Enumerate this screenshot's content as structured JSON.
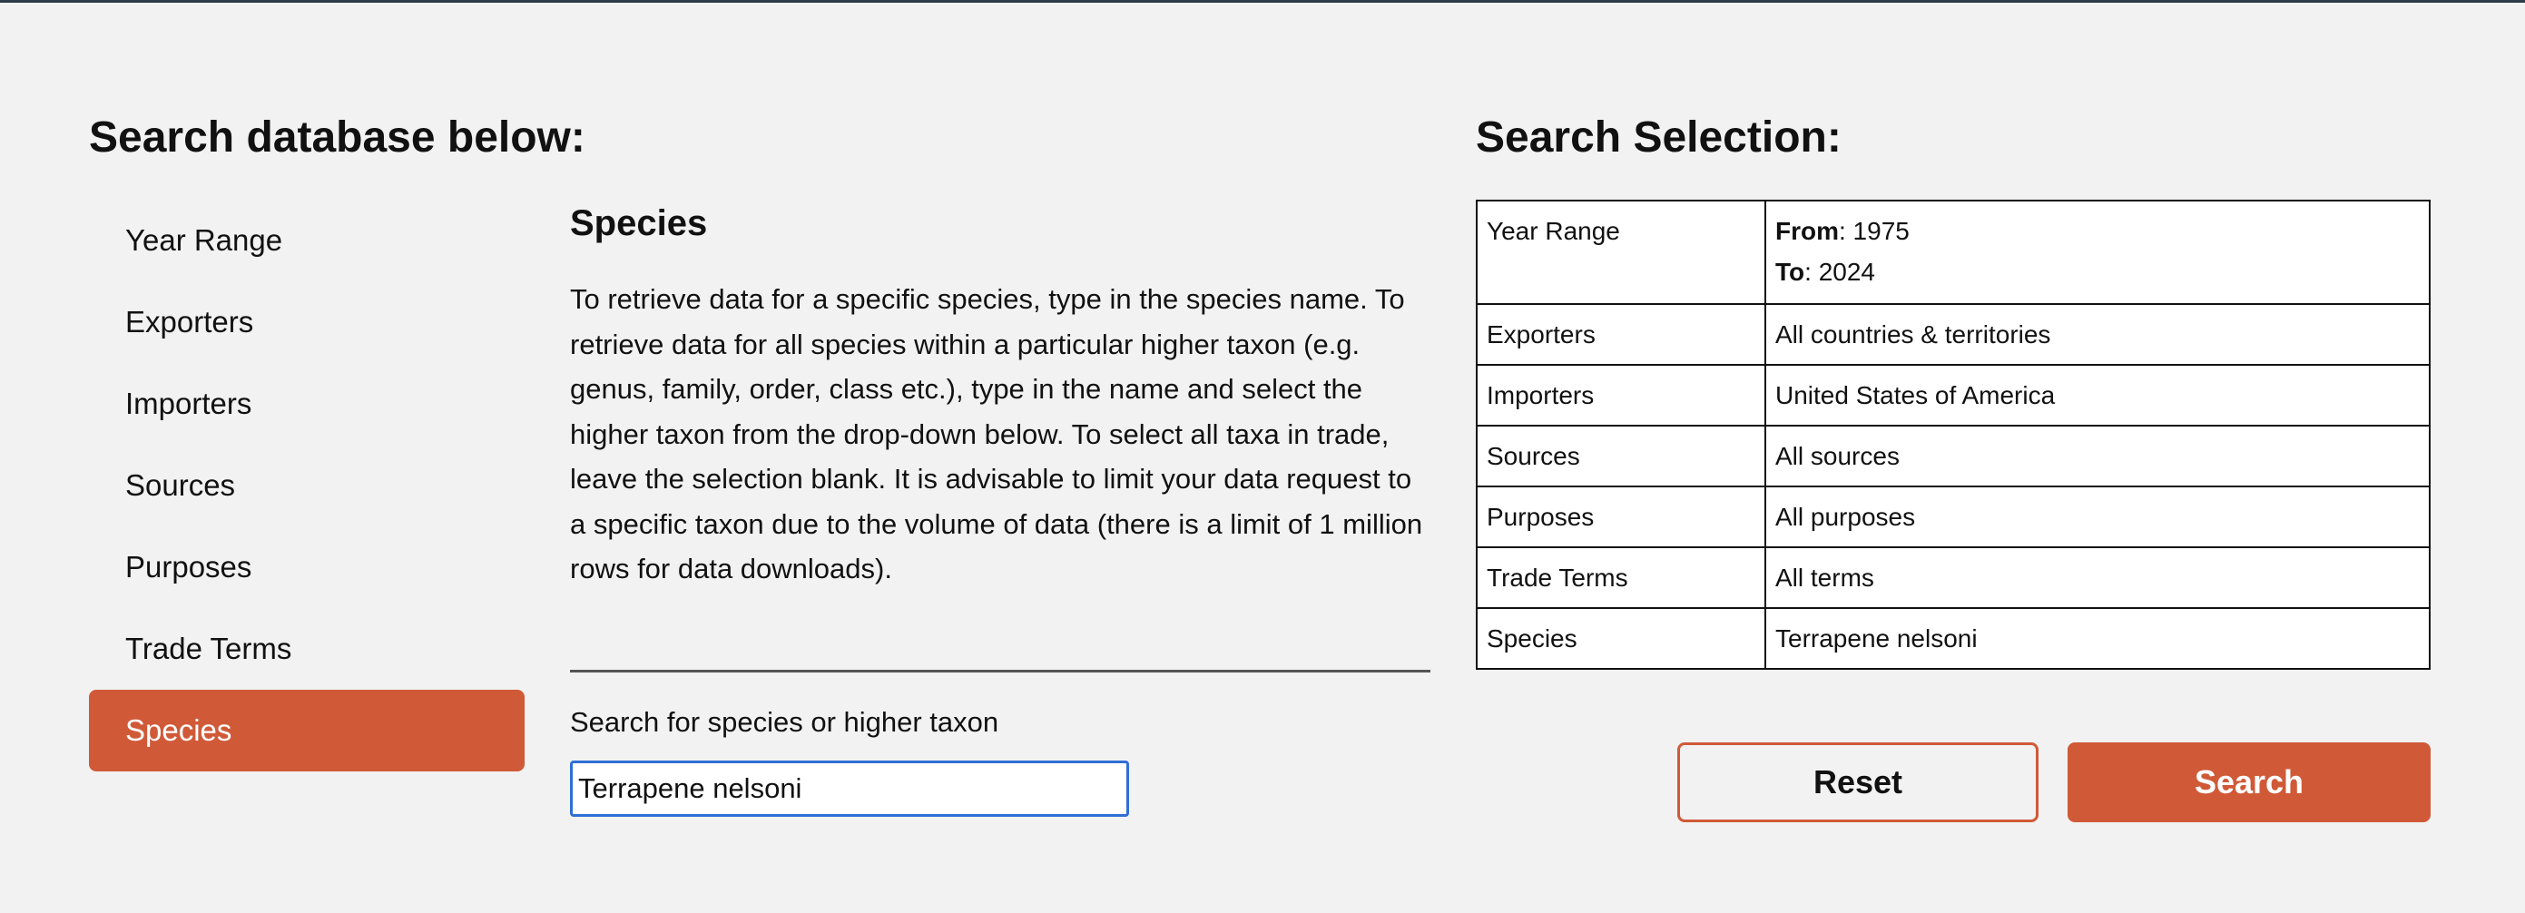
{
  "left_heading": "Search database below:",
  "right_heading": "Search Selection:",
  "sidebar": {
    "items": [
      {
        "label": "Year Range",
        "active": false
      },
      {
        "label": "Exporters",
        "active": false
      },
      {
        "label": "Importers",
        "active": false
      },
      {
        "label": "Sources",
        "active": false
      },
      {
        "label": "Purposes",
        "active": false
      },
      {
        "label": "Trade Terms",
        "active": false
      },
      {
        "label": "Species",
        "active": true
      }
    ]
  },
  "panel": {
    "title": "Species",
    "description": "To retrieve data for a specific species, type in the species name. To retrieve data for all species within a particular higher taxon (e.g. genus, family, order, class etc.), type in the name and select the higher taxon from the drop-down below. To select all taxa in trade, leave the selection blank. It is advisable to limit your data request to a specific taxon due to the volume of data (there is a limit of 1 million rows for data downloads).",
    "search_label": "Search for species or higher taxon",
    "search_value": "Terrapene nelsoni"
  },
  "selection": {
    "year_range": {
      "key": "Year Range",
      "from_label": "From",
      "from_value": ": 1975",
      "to_label": "To",
      "to_value": ": 2024"
    },
    "rows": [
      {
        "key": "Exporters",
        "value": "All countries & territories"
      },
      {
        "key": "Importers",
        "value": "United States of America"
      },
      {
        "key": "Sources",
        "value": "All sources"
      },
      {
        "key": "Purposes",
        "value": "All purposes"
      },
      {
        "key": "Trade Terms",
        "value": "All terms"
      },
      {
        "key": "Species",
        "value": "Terrapene nelsoni"
      }
    ]
  },
  "buttons": {
    "reset_label": "Reset",
    "search_label": "Search"
  },
  "colors": {
    "accent": "#d05a38",
    "focus": "#2f6fd6",
    "background": "#f2f2f2"
  }
}
